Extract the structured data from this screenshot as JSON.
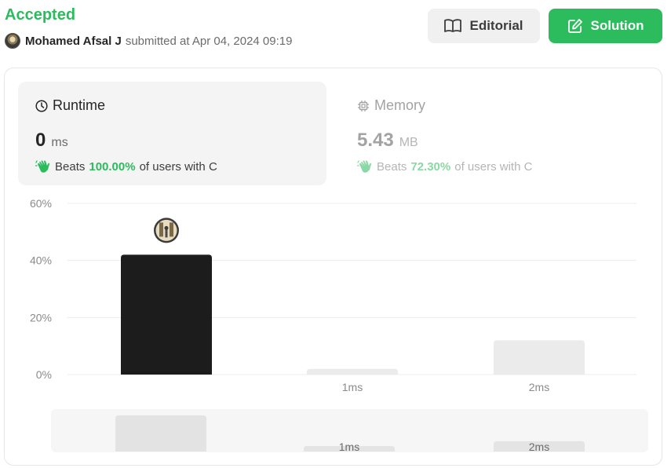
{
  "header": {
    "status": "Accepted",
    "username": "Mohamed Afsal J",
    "submitted_text": "submitted at Apr 04, 2024 09:19"
  },
  "buttons": {
    "editorial_label": "Editorial",
    "solution_label": "Solution"
  },
  "runtime": {
    "label": "Runtime",
    "value": "0",
    "unit": "ms",
    "beats_prefix": "Beats",
    "beats_pct": "100.00%",
    "beats_suffix": "of users with C"
  },
  "memory": {
    "label": "Memory",
    "value": "5.43",
    "unit": "MB",
    "beats_prefix": "Beats",
    "beats_pct": "72.30%",
    "beats_suffix": "of users with C"
  },
  "colors": {
    "accent_green": "#2cbb5d",
    "selected_bar": "#1c1c1c",
    "bar": "#ebebeb"
  },
  "chart_data": {
    "type": "bar",
    "categories": [
      "0ms",
      "1ms",
      "2ms"
    ],
    "x_tick_labels": [
      "",
      "1ms",
      "2ms"
    ],
    "values": [
      42,
      2,
      12
    ],
    "selected_index": 0,
    "y_ticks": [
      "0%",
      "20%",
      "40%",
      "60%"
    ],
    "ylim": [
      0,
      60
    ],
    "grid": true,
    "minimap": {
      "values": [
        42,
        2,
        12
      ],
      "tick_labels": [
        "",
        "1ms",
        "2ms"
      ]
    }
  }
}
